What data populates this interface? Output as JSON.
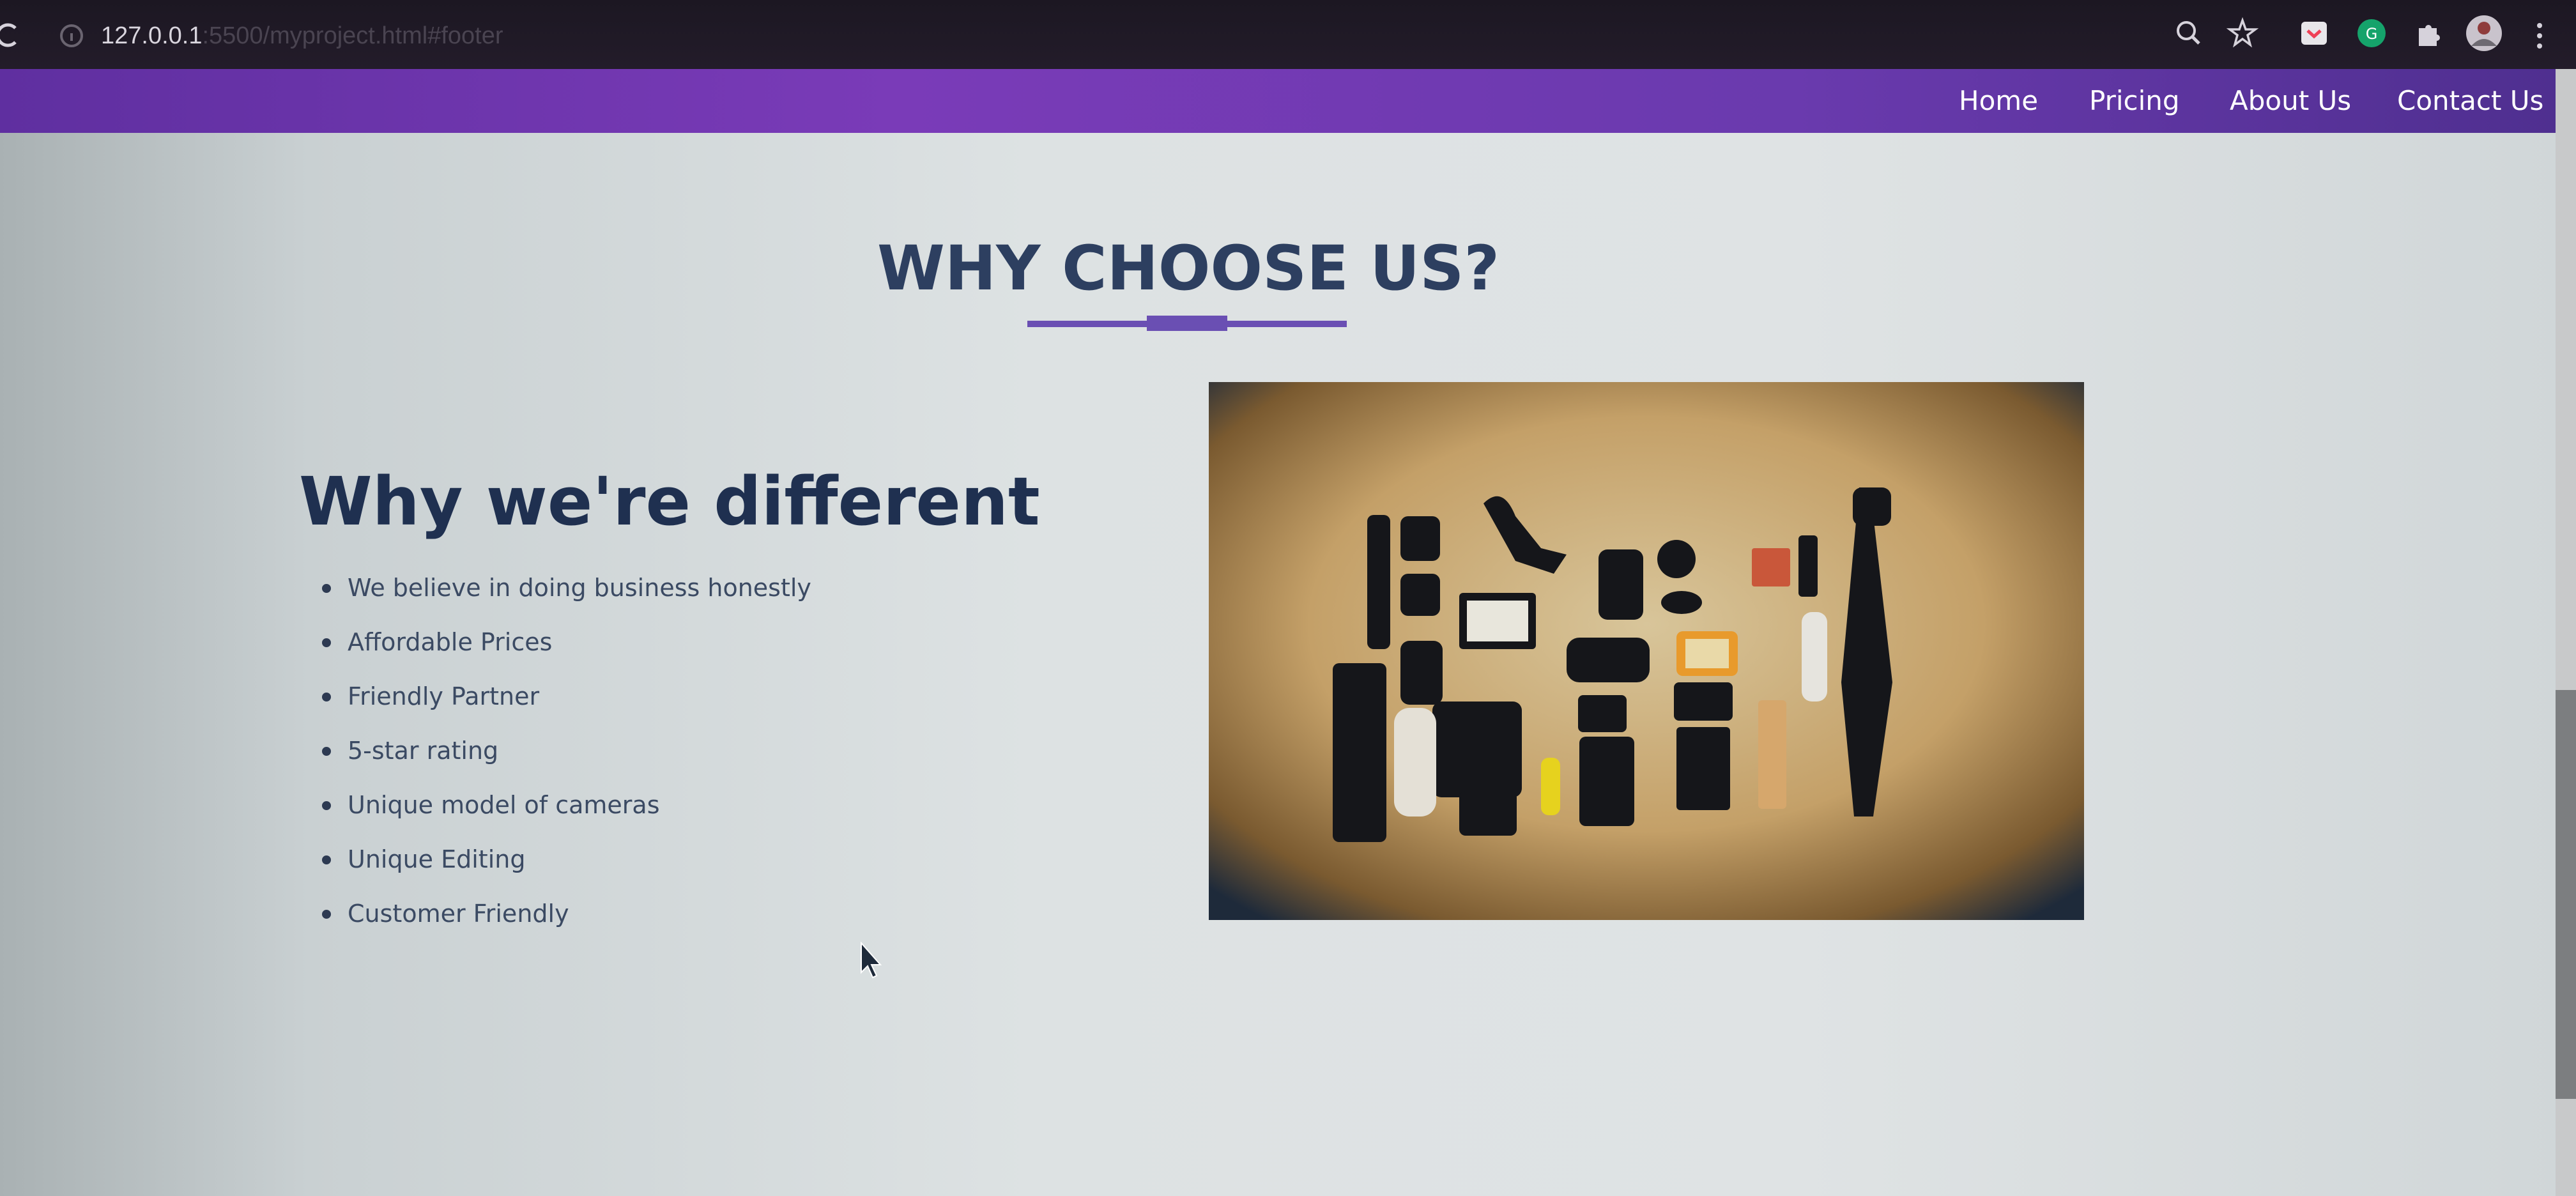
{
  "browser": {
    "url_host": "127.0.0.1",
    "url_rest": ":5500/myproject.html#footer"
  },
  "nav": {
    "links": [
      "Home",
      "Pricing",
      "About Us",
      "Contact Us"
    ]
  },
  "section": {
    "title": "WHY CHOOSE US?",
    "subtitle": "Why we're different",
    "features": [
      "We believe in doing business honestly",
      "Affordable Prices",
      "Friendly Partner",
      "5-star rating",
      "Unique model of cameras",
      "Unique Editing",
      "Customer Friendly"
    ]
  },
  "colors": {
    "nav_gradient_start": "#5f2fa0",
    "nav_gradient_mid": "#7a3bb8",
    "heading": "#2d3f60",
    "accent_underline": "#6a4fb3",
    "text": "#3b4a63"
  },
  "icons": [
    "reload-icon",
    "site-info-icon",
    "zoom-icon",
    "star-icon",
    "pocket-icon",
    "grammarly-icon",
    "extensions-icon",
    "profile-avatar-icon",
    "menu-kebab-icon",
    "mouse-cursor-icon"
  ]
}
